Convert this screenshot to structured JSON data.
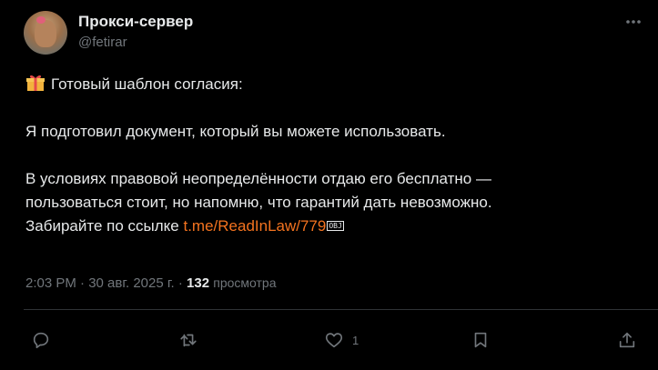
{
  "author": {
    "display_name": "Прокси-сервер",
    "handle": "@fetirar"
  },
  "post": {
    "line1": "Готовый шаблон согласия:",
    "line2": "Я подготовил документ, который вы можете использовать.",
    "line3": "В условиях правовой неопределённости отдаю его бесплатно —",
    "line4": "пользоваться стоит, но напомню, что гарантий дать невозможно.",
    "line5_prefix": "Забирайте по ссылке ",
    "link_text": "t.me/ReadInLaw/779",
    "obj_glyph": "OBJ"
  },
  "meta": {
    "timestamp": "2:03 PM · 30 авг. 2025 г.",
    "separator": " · ",
    "views_count": "132",
    "views_label": "просмотра"
  },
  "actions": {
    "likes_count": "1"
  },
  "colors": {
    "background": "#000000",
    "text": "#e7e9ea",
    "secondary": "#71767b",
    "link": "#f4731f",
    "divider": "#2f3336"
  },
  "icons": [
    "more-icon",
    "gift-emoji",
    "reply-icon",
    "repost-icon",
    "like-icon",
    "bookmark-icon",
    "share-icon"
  ]
}
